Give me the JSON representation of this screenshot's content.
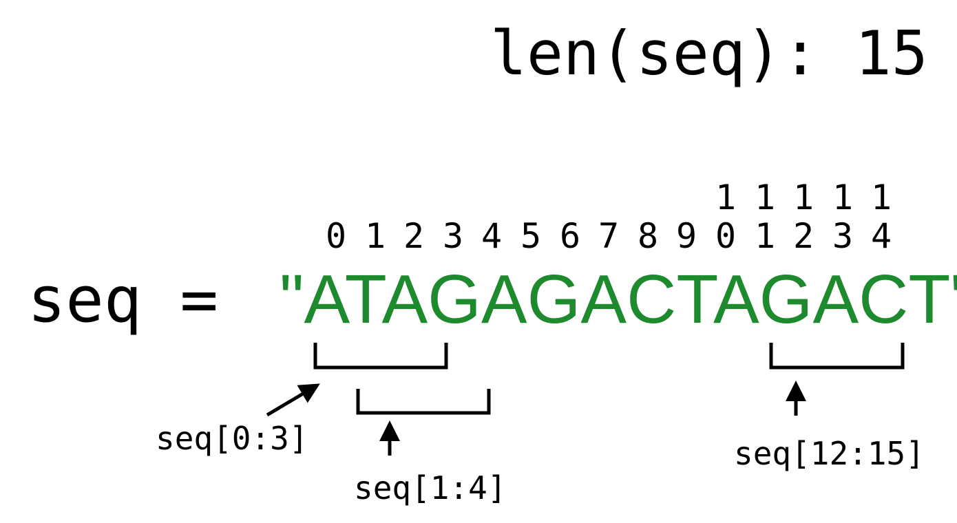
{
  "length_label": "len(seq): 15",
  "variable": "seq =",
  "sequence_string": "\"ATAGAGACTAGACT\"",
  "indices": [
    {
      "tens": "",
      "ones": "0"
    },
    {
      "tens": "",
      "ones": "1"
    },
    {
      "tens": "",
      "ones": "2"
    },
    {
      "tens": "",
      "ones": "3"
    },
    {
      "tens": "",
      "ones": "4"
    },
    {
      "tens": "",
      "ones": "5"
    },
    {
      "tens": "",
      "ones": "6"
    },
    {
      "tens": "",
      "ones": "7"
    },
    {
      "tens": "",
      "ones": "8"
    },
    {
      "tens": "",
      "ones": "9"
    },
    {
      "tens": "1",
      "ones": "0"
    },
    {
      "tens": "1",
      "ones": "1"
    },
    {
      "tens": "1",
      "ones": "2"
    },
    {
      "tens": "1",
      "ones": "3"
    },
    {
      "tens": "1",
      "ones": "4"
    }
  ],
  "slices": [
    {
      "label": "seq[0:3]"
    },
    {
      "label": "seq[1:4]"
    },
    {
      "label": "seq[12:15]"
    }
  ],
  "colors": {
    "sequence": "#1e8a2e",
    "text": "#000000"
  }
}
